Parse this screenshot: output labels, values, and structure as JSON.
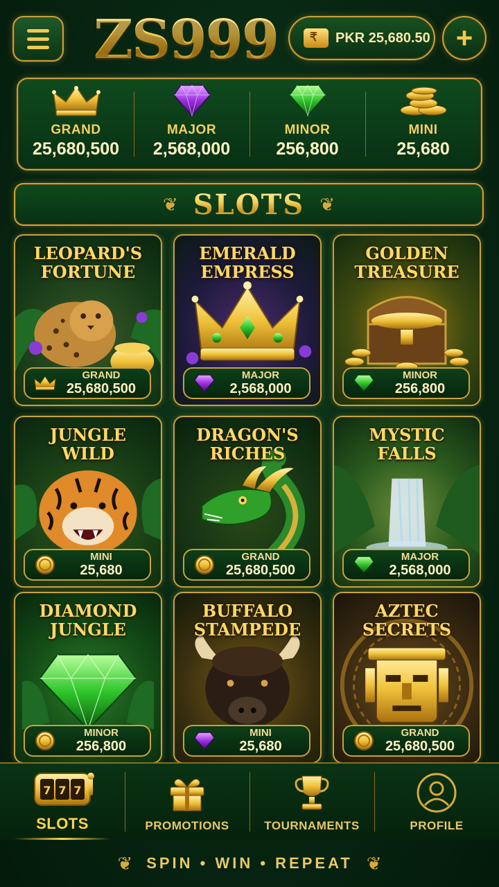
{
  "header": {
    "logo": "ZS999",
    "balance": "PKR 25,680.50",
    "plus": "+"
  },
  "jackpots": [
    {
      "label": "GRAND",
      "value": "25,680,500",
      "icon": "crown-icon"
    },
    {
      "label": "MAJOR",
      "value": "2,568,000",
      "icon": "purple-gem-icon"
    },
    {
      "label": "MINOR",
      "value": "256,800",
      "icon": "green-gem-icon"
    },
    {
      "label": "MINI",
      "value": "25,680",
      "icon": "coins-icon"
    }
  ],
  "section": {
    "title": "SLOTS"
  },
  "games": [
    {
      "title_l1": "LEOPARD'S",
      "title_l2": "FORTUNE",
      "tier": "GRAND",
      "value": "25,680,500",
      "icon": "crown-icon"
    },
    {
      "title_l1": "EMERALD",
      "title_l2": "EMPRESS",
      "tier": "MAJOR",
      "value": "2,568,000",
      "icon": "purple-gem-icon"
    },
    {
      "title_l1": "GOLDEN",
      "title_l2": "TREASURE",
      "tier": "MINOR",
      "value": "256,800",
      "icon": "green-gem-icon"
    },
    {
      "title_l1": "JUNGLE",
      "title_l2": "WILD",
      "tier": "MINI",
      "value": "25,680",
      "icon": "coin-icon"
    },
    {
      "title_l1": "DRAGON'S",
      "title_l2": "RICHES",
      "tier": "GRAND",
      "value": "25,680,500",
      "icon": "coin-icon"
    },
    {
      "title_l1": "MYSTIC",
      "title_l2": "FALLS",
      "tier": "MAJOR",
      "value": "2,568,000",
      "icon": "green-gem-icon"
    },
    {
      "title_l1": "DIAMOND",
      "title_l2": "JUNGLE",
      "tier": "MINOR",
      "value": "256,800",
      "icon": "coin-icon"
    },
    {
      "title_l1": "BUFFALO",
      "title_l2": "STAMPEDE",
      "tier": "MINI",
      "value": "25,680",
      "icon": "purple-gem-icon"
    },
    {
      "title_l1": "AZTEC",
      "title_l2": "SECRETS",
      "tier": "GRAND",
      "value": "25,680,500",
      "icon": "coin-icon"
    }
  ],
  "nav": [
    {
      "label": "SLOTS",
      "icon": "slot-machine-icon",
      "active": true
    },
    {
      "label": "PROMOTIONS",
      "icon": "gift-icon",
      "active": false
    },
    {
      "label": "TOURNAMENTS",
      "icon": "trophy-icon",
      "active": false
    },
    {
      "label": "PROFILE",
      "icon": "user-icon",
      "active": false
    }
  ],
  "tagline": "SPIN • WIN • REPEAT",
  "colors": {
    "background": "#072612",
    "gold": "#c9a13a",
    "accent": "#ffd54a"
  }
}
